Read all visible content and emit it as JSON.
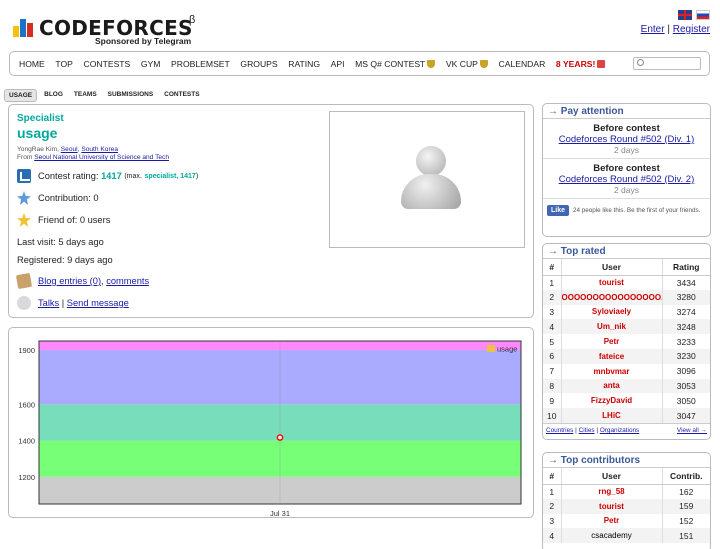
{
  "header": {
    "logo_text": "CODEFORCES",
    "beta_mark": "β",
    "sponsor": "Sponsored by Telegram",
    "enter_label": "Enter",
    "separator": "|",
    "register_label": "Register"
  },
  "main_nav": [
    {
      "label": "Home"
    },
    {
      "label": "Top"
    },
    {
      "label": "Contests"
    },
    {
      "label": "Gym"
    },
    {
      "label": "Problemset"
    },
    {
      "label": "Groups"
    },
    {
      "label": "Rating"
    },
    {
      "label": "API"
    },
    {
      "label": "MS Q# Contest",
      "icon": "trophy-icon"
    },
    {
      "label": "VK Cup",
      "icon": "trophy-icon"
    },
    {
      "label": "Calendar"
    },
    {
      "label": "8 years!",
      "icon": "gift-icon",
      "highlight": "#cc0000"
    }
  ],
  "sub_nav": [
    {
      "label": "USAGE",
      "active": true
    },
    {
      "label": "BLOG"
    },
    {
      "label": "TEAMS"
    },
    {
      "label": "SUBMISSIONS"
    },
    {
      "label": "CONTESTS"
    }
  ],
  "profile": {
    "rank": "Specialist",
    "handle": "usage",
    "name": "YongRae Kim,",
    "city": "Seoul",
    "country": "South Korea",
    "from_label": "From",
    "organization": "Seoul National University of Science and Tech",
    "rating_label": "Contest rating:",
    "rating_value": "1417",
    "rating_max_prefix": "(max.",
    "rating_max_rank": "specialist, 1417",
    "rating_max_suffix": ")",
    "contribution_label": "Contribution:",
    "contribution_value": "0",
    "friend_label": "Friend of: 0 users",
    "last_visit": "Last visit: 5 days ago",
    "registered": "Registered: 9 days ago",
    "blog_entries": "Blog entries (0)",
    "comma": ",",
    "comments": "comments",
    "talks": "Talks",
    "pipe": "|",
    "send_message": "Send message"
  },
  "chart_data": {
    "type": "line",
    "series": [
      {
        "name": "usage",
        "x": [
          "Jul 31"
        ],
        "y": [
          1417
        ]
      }
    ],
    "x_ticks": [
      "Jul 31"
    ],
    "y_ticks": [
      1200,
      1400,
      1600,
      1900
    ],
    "ylim": [
      1050,
      1950
    ],
    "bands": [
      {
        "from": 1050,
        "to": 1200,
        "color": "#cccccc"
      },
      {
        "from": 1200,
        "to": 1400,
        "color": "#77ff77"
      },
      {
        "from": 1400,
        "to": 1600,
        "color": "#77ddbb"
      },
      {
        "from": 1600,
        "to": 1900,
        "color": "#aaaaff"
      },
      {
        "from": 1900,
        "to": 1950,
        "color": "#ff88ff"
      }
    ],
    "legend_position": "top-right",
    "point_color": "#ff0000",
    "legend_color": "#edc240"
  },
  "sidebar": {
    "attention": {
      "title": "→ Pay attention",
      "contests": [
        {
          "title": "Before contest",
          "name": "Codeforces Round #502 (Div. 1)",
          "when": "2 days"
        },
        {
          "title": "Before contest",
          "name": "Codeforces Round #502 (Div. 2)",
          "when": "2 days"
        }
      ],
      "like_label": "Like",
      "like_text": "24 people like this. Be the first of your friends."
    },
    "top_rated": {
      "title": "→ Top rated",
      "headers": [
        "#",
        "User",
        "Rating"
      ],
      "rows": [
        {
          "n": "1",
          "user": "tourist",
          "val": "3434"
        },
        {
          "n": "2",
          "user": "OOOOOOOOOOOOOOOO...O",
          "val": "3280"
        },
        {
          "n": "3",
          "user": "Syloviaely",
          "val": "3274"
        },
        {
          "n": "4",
          "user": "Um_nik",
          "val": "3248"
        },
        {
          "n": "5",
          "user": "Petr",
          "val": "3233"
        },
        {
          "n": "6",
          "user": "fateice",
          "val": "3230"
        },
        {
          "n": "7",
          "user": "mnbvmar",
          "val": "3096"
        },
        {
          "n": "8",
          "user": "anta",
          "val": "3053"
        },
        {
          "n": "9",
          "user": "FizzyDavid",
          "val": "3050"
        },
        {
          "n": "10",
          "user": "LHiC",
          "val": "3047"
        }
      ],
      "footer_countries": "Countries",
      "footer_cities": "Cities",
      "footer_orgs": "Organizations",
      "footer_sep": "|",
      "view_all": "View all →"
    },
    "top_contrib": {
      "title": "→ Top contributors",
      "headers": [
        "#",
        "User",
        "Contrib."
      ],
      "rows": [
        {
          "n": "1",
          "user": "rng_58",
          "val": "162"
        },
        {
          "n": "2",
          "user": "tourist",
          "val": "159"
        },
        {
          "n": "3",
          "user": "Petr",
          "val": "152"
        },
        {
          "n": "4",
          "user": "csacademy",
          "val": "151",
          "plain": true
        }
      ]
    }
  }
}
